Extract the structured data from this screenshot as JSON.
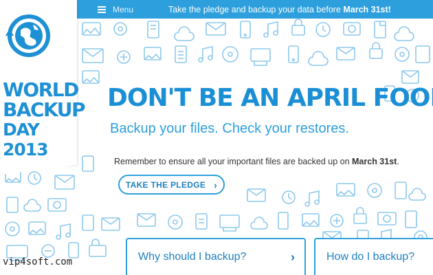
{
  "topbar": {
    "menu_label": "Menu",
    "banner_text": "Take the pledge and backup your data before ",
    "banner_date": "March 31st!"
  },
  "logo": {
    "line1": "WORLD",
    "line2": "BACKUP",
    "line3": "DAY 2013"
  },
  "main": {
    "headline": "DON'T BE AN APRIL FOOL.",
    "subheadline": "Backup your files. Check your restores.",
    "remember_text": "Remember to ensure all your important files are backed up on ",
    "remember_date": "March 31st",
    "remember_end": ".",
    "pledge_button": "TAKE THE PLEDGE"
  },
  "cards": {
    "why": "Why should I backup?",
    "how": "How do I backup?"
  },
  "watermark": "vip4soft.com",
  "colors": {
    "brand_blue": "#2d9fdc",
    "headline_blue": "#1a8fd5",
    "doodle_blue": "#8cc8ec"
  },
  "icons": [
    "hamburger-icon",
    "globe-arrow-icon",
    "chevron-right-icon"
  ]
}
